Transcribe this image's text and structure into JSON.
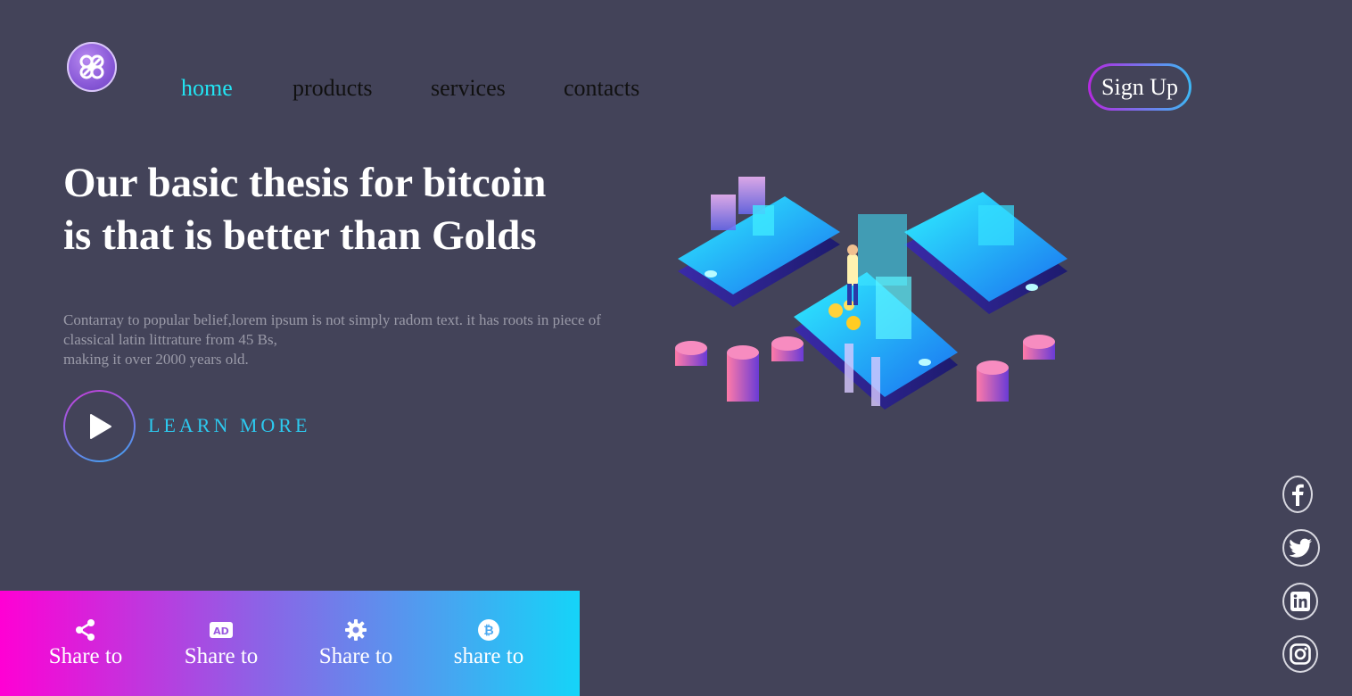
{
  "nav": {
    "items": [
      {
        "label": "home",
        "active": true
      },
      {
        "label": "products",
        "active": false
      },
      {
        "label": "services",
        "active": false
      },
      {
        "label": "contacts",
        "active": false
      }
    ],
    "signup_label": "Sign Up"
  },
  "hero": {
    "headline_line1": "Our basic thesis for bitcoin",
    "headline_line2": "is that is better than Golds",
    "paragraph_line1": "Contarray to popular belief,lorem ipsum is not simply radom text. it has roots in piece of",
    "paragraph_line2": "classical latin littrature from 45 Bs,",
    "paragraph_line3": "making it over 2000 years old.",
    "learn_more": "LEARN MORE"
  },
  "share": {
    "items": [
      {
        "icon": "share-icon",
        "label": "Share to"
      },
      {
        "icon": "ad-icon",
        "label": "Share to"
      },
      {
        "icon": "gear-icon",
        "label": "Share to"
      },
      {
        "icon": "bitcoin-icon",
        "label": "share to"
      }
    ]
  },
  "social": [
    "facebook-icon",
    "twitter-icon",
    "linkedin-icon",
    "instagram-icon"
  ],
  "colors": {
    "background": "#434359",
    "accent_cyan": "#22e5f3",
    "gradient_pink": "#ff00d4",
    "gradient_blue": "#15d4f8"
  }
}
